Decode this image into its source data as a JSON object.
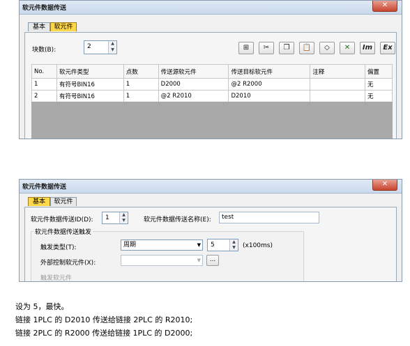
{
  "dialog1": {
    "title": "软元件数据传送",
    "close_label": "✕",
    "tabs": [
      "基本",
      "软元件"
    ],
    "block_count_label": "块数(B):",
    "block_count_value": "2",
    "toolbar_icons": [
      "insert-row-icon",
      "cut-icon",
      "copy-icon",
      "paste-icon",
      "eraser-icon",
      "delete-icon",
      "im-icon",
      "ex-icon"
    ],
    "toolbar_text": {
      "im": "Im",
      "ex": "Ex"
    },
    "table": {
      "headers": [
        "No.",
        "软元件类型",
        "点数",
        "传送源软元件",
        "传送目标软元件",
        "注释",
        "偏置"
      ],
      "rows": [
        [
          "1",
          "有符号BIN16",
          "1",
          "D2000",
          "@2 R2000",
          "",
          "无"
        ],
        [
          "2",
          "有符号BIN16",
          "1",
          "@2 R2010",
          "D2010",
          "",
          "无"
        ]
      ]
    }
  },
  "dialog2": {
    "title": "软元件数据传送",
    "close_label": "✕",
    "tabs": [
      "基本",
      "软元件"
    ],
    "id_label": "软元件数据传送ID(D):",
    "id_value": "1",
    "name_label": "软元件数据传送名称(E):",
    "name_value": "test",
    "trigger_group_label": "软元件数据传送触发",
    "trigger_type_label": "触发类型(T):",
    "trigger_type_value": "周期",
    "period_value": "5",
    "period_unit": "(x100ms)",
    "ext_ctrl_label": "外部控制软元件(X):",
    "ext_ctrl_btn": "...",
    "trigger_device_label": "触发软元件"
  },
  "notes": [
    "设为 5，最快。",
    "链接 1PLC 的 D2010 传送给链接 2PLC 的 R2010;",
    "链接 2PLC 的 R2000 传送给链接 1PLC 的 D2000;"
  ]
}
